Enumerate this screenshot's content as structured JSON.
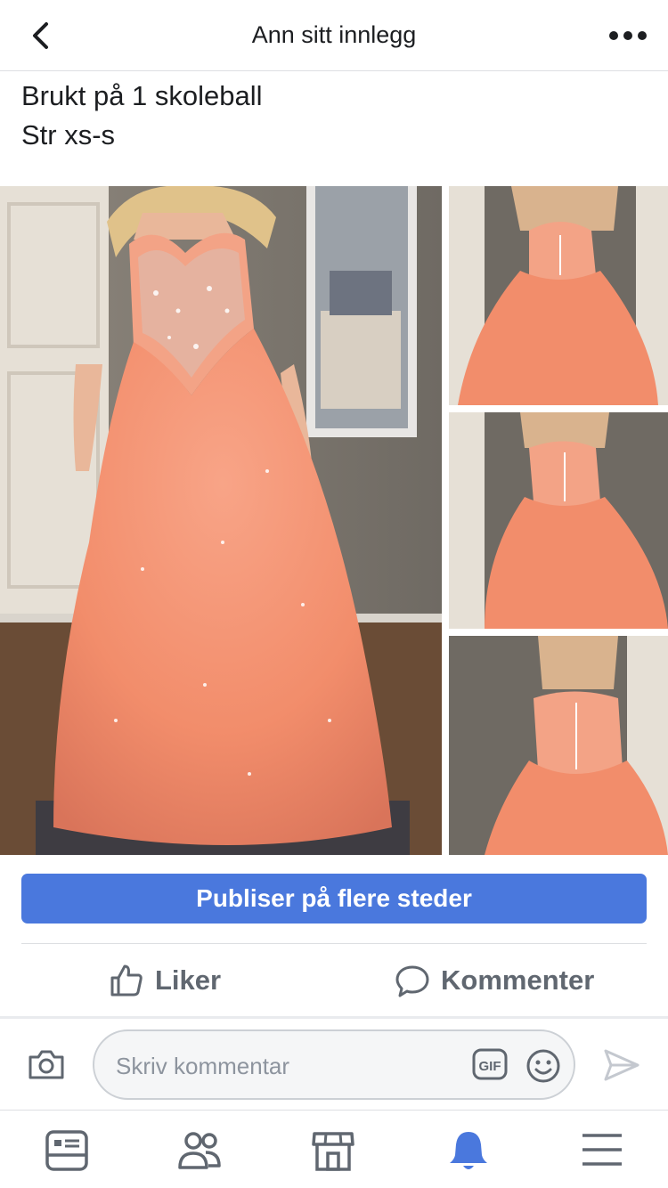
{
  "header": {
    "title": "Ann sitt innlegg",
    "back_icon": "chevron-left-icon",
    "more_icon": "more-horizontal-icon"
  },
  "post": {
    "lines": [
      "Brukt på 1 skoleball",
      "Str xs-s"
    ],
    "photos": [
      {
        "name": "photo-main",
        "description_icon": "image"
      },
      {
        "name": "photo-back-1",
        "description_icon": "image"
      },
      {
        "name": "photo-back-2",
        "description_icon": "image"
      },
      {
        "name": "photo-back-3",
        "description_icon": "image"
      }
    ]
  },
  "publish_button": {
    "label": "Publiser på flere steder"
  },
  "actions": {
    "like_label": "Liker",
    "comment_label": "Kommenter"
  },
  "composer": {
    "placeholder": "Skriv kommentar",
    "gif_label": "GIF"
  },
  "tabbar": {
    "items": [
      {
        "icon": "news-feed-icon"
      },
      {
        "icon": "friends-icon"
      },
      {
        "icon": "marketplace-icon"
      },
      {
        "icon": "notifications-icon",
        "active": true
      },
      {
        "icon": "menu-icon"
      }
    ]
  },
  "colors": {
    "accent": "#4a78dd",
    "text": "#1c1e21",
    "muted": "#606770",
    "dress": "#f4906e"
  }
}
